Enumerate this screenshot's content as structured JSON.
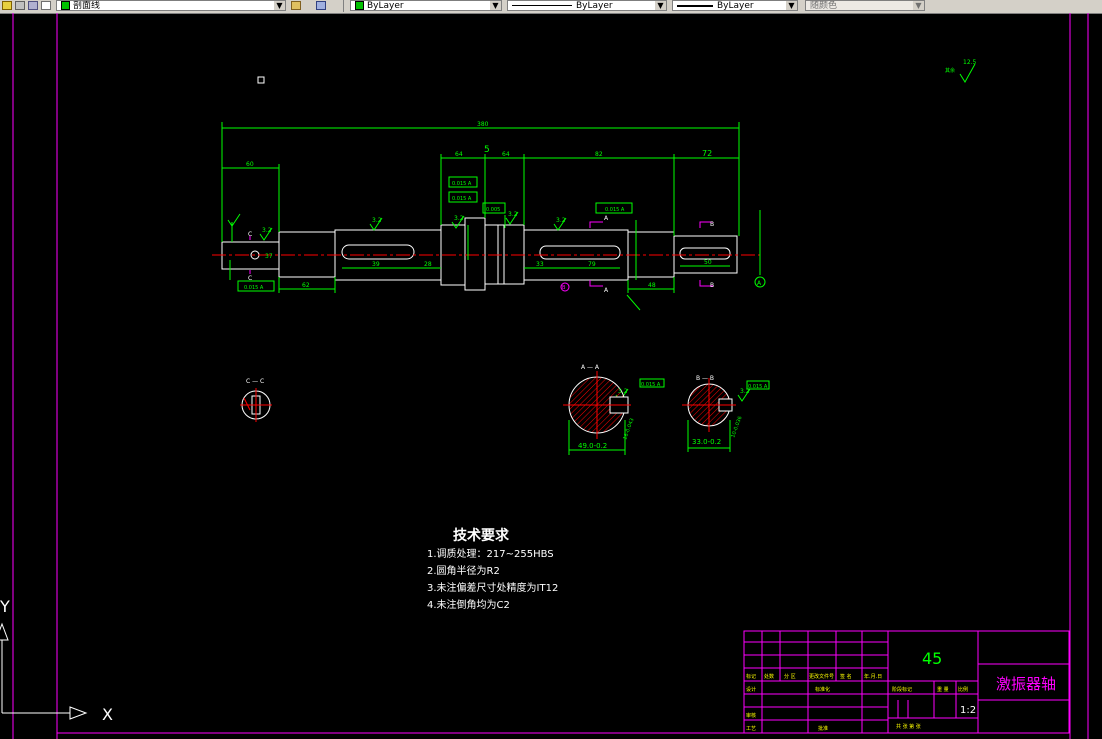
{
  "toolbar": {
    "layer_name": "剖面线",
    "color_value": "ByLayer",
    "linetype_value": "ByLayer",
    "lineweight_value": "ByLayer",
    "plotstyle_value": "随颜色"
  },
  "drawing": {
    "dims": {
      "total": "380",
      "d60": "60",
      "d64a": "64",
      "d5": "5",
      "d64b": "64",
      "d82": "82",
      "d72": "72",
      "d62": "62",
      "d48": "48",
      "d39": "39",
      "d28": "28",
      "d79": "79",
      "d50": "50",
      "d37": "37",
      "d33": "33"
    },
    "tolerances": {
      "t1": "0.015 A",
      "t2": "0.015 A",
      "t3": "0.005",
      "t4": "0.015 A",
      "t5": "0.015 A",
      "t6": "0.015 A",
      "t7": "0.015 A"
    },
    "roughness": {
      "r32a": "3.2",
      "r32b": "3.2",
      "r32c": "3.2",
      "r32d": "3.2",
      "r32e": "3.2",
      "r32f": "3.2",
      "r32g": "3.2",
      "r125": "12.5",
      "rest": "其余"
    },
    "labels": {
      "cutC1": "C",
      "cutC2": "C",
      "cutA1": "A",
      "cutA2": "A",
      "cutB1": "B",
      "cutB2": "B",
      "datumA": "A",
      "datumB": "B",
      "sectionCC": "C — C",
      "sectionAA": "A — A",
      "sectionBB": "B — B",
      "aa_dim1": "49.0-0.2",
      "aa_dim2": "16-0.043",
      "bb_dim1": "33.0-0.2",
      "bb_dim2": "10-0.036"
    },
    "notes": {
      "title": "技术要求",
      "line1": "1.调质处理：217~255HBS",
      "line2": "2.圆角半径为R2",
      "line3": "3.未注偏差尺寸处精度为IT12",
      "line4": "4.未注倒角均为C2"
    },
    "title_block": {
      "material": "45",
      "part_name": "激振器轴",
      "scale": "1:2",
      "h_mark": "标记",
      "h_count": "处数",
      "h_zone": "分 区",
      "h_docno": "更改文件号",
      "h_sign": "签 名",
      "h_date": "年.月.日",
      "h_design": "设计",
      "h_std": "标准化",
      "h_stage": "阶段标记",
      "h_weight": "重 量",
      "h_ratio": "比例",
      "h_review": "审核",
      "h_craft": "工艺",
      "h_approve": "批准",
      "h_sheets": "共  张  第  张"
    },
    "ucs": {
      "x": "X",
      "y": "Y"
    }
  },
  "colors": {
    "green": "#00ff00",
    "red": "#ff0000",
    "magenta": "#ff00ff",
    "white": "#ffffff",
    "toolbar": "#d4d0c8"
  }
}
